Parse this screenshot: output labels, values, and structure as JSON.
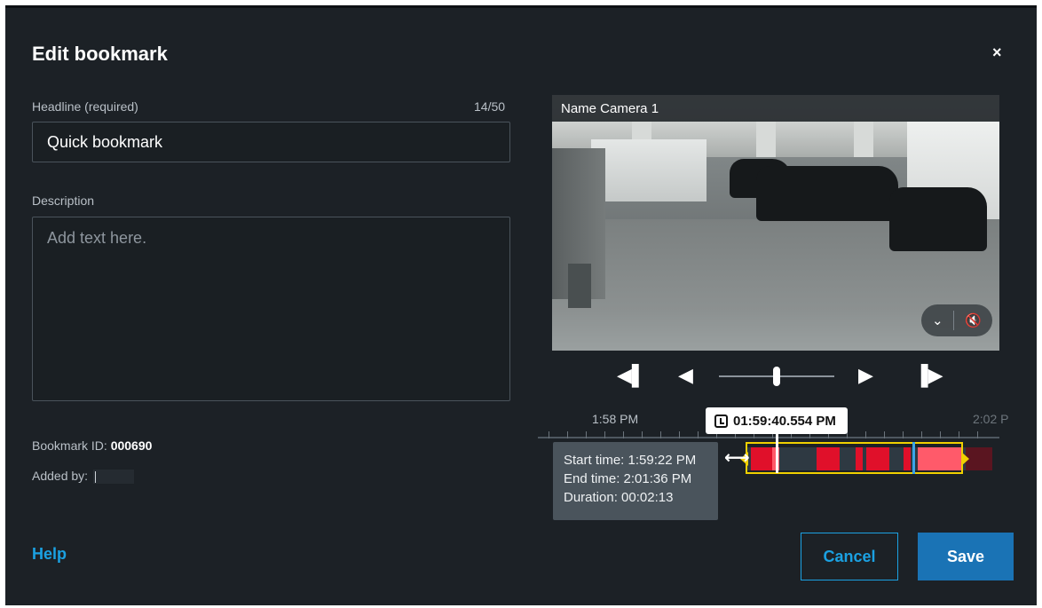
{
  "dialog": {
    "title": "Edit bookmark",
    "close_glyph": "×"
  },
  "headline": {
    "label": "Headline (required)",
    "counter": "14/50",
    "value": "Quick bookmark"
  },
  "description": {
    "label": "Description",
    "placeholder": "Add text here."
  },
  "meta": {
    "bookmark_id_label": "Bookmark ID:",
    "bookmark_id_value": "000690",
    "added_by_label": "Added by:"
  },
  "video": {
    "camera_name": "Name Camera 1",
    "audio_toggle_icon": "chevron-down-icon",
    "mute_icon": "speaker-muted-icon",
    "chevron_glyph": "⌄",
    "mute_glyph": "🔇"
  },
  "playback": {
    "prev_frame_glyph": "◀▌",
    "step_back_glyph": "◀",
    "step_forward_glyph": "▶",
    "next_frame_glyph": "▐▶",
    "speed_position": 0.5
  },
  "timeline": {
    "label_left": "1:58 PM",
    "label_right": "2:02 P",
    "current_time": "01:59:40.554 PM",
    "resize_glyph": "⟷",
    "colors": {
      "selection": "#f0d000",
      "motion_red": "#e0102a",
      "motion_pink": "#ff5a6a",
      "marker_blue": "#3aa5e8"
    }
  },
  "tooltip": {
    "start": "Start time: 1:59:22 PM",
    "end": "End time: 2:01:36 PM",
    "duration": "Duration: 00:02:13"
  },
  "footer": {
    "help": "Help",
    "cancel": "Cancel",
    "save": "Save"
  },
  "colors": {
    "background": "#1c2126",
    "accent": "#1ba1e2",
    "save_button": "#1a73b5"
  }
}
